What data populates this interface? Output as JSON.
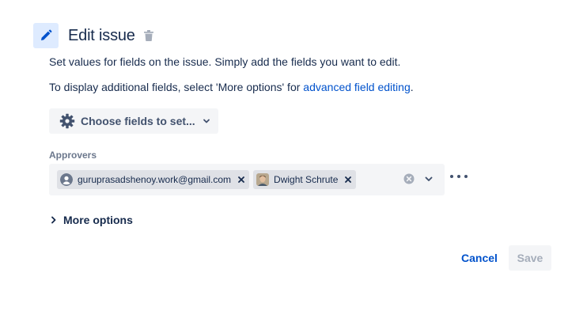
{
  "header": {
    "icon": "pencil-icon",
    "title": "Edit issue",
    "delete_icon": "trash-icon"
  },
  "description": {
    "line1": "Set values for fields on the issue. Simply add the fields you want to edit.",
    "line2_prefix": "To display additional fields, select 'More options' for ",
    "line2_link": "advanced field editing",
    "line2_suffix": "."
  },
  "choose_fields": {
    "icon": "gear-icon",
    "label": "Choose fields to set...",
    "chevron": "chevron-down-icon"
  },
  "approvers": {
    "label": "Approvers",
    "selected": [
      {
        "label": "guruprasadshenoy.work@gmail.com",
        "avatar": "default-user-avatar"
      },
      {
        "label": "Dwight Schrute",
        "avatar": "user-photo-avatar"
      }
    ],
    "clear_icon": "clear-icon",
    "dropdown_icon": "chevron-down-icon"
  },
  "more_actions_icon": "more-horizontal-icon",
  "more_options": {
    "icon": "chevron-right-icon",
    "label": "More options"
  },
  "footer": {
    "cancel_label": "Cancel",
    "save_label": "Save"
  },
  "colors": {
    "link": "#0052cc",
    "text": "#172b4d",
    "field_bg": "#f4f5f7",
    "tag_bg": "#dfe1e6",
    "icon_bg": "#deebff"
  }
}
